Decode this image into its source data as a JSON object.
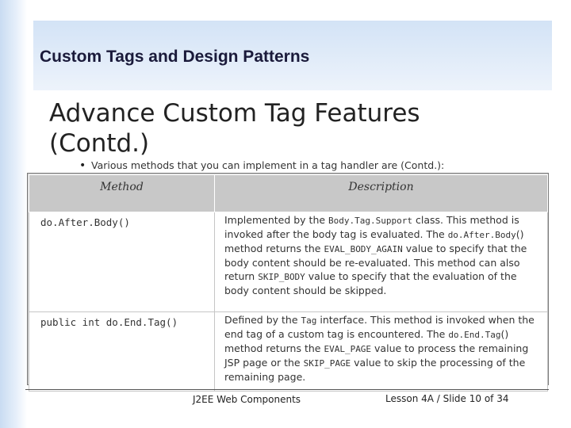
{
  "header": {
    "title": "Custom Tags and Design Patterns"
  },
  "slide": {
    "title": "Advance Custom Tag Features (Contd.)"
  },
  "bullet": {
    "marker": "•",
    "text": "Various  methods that you can implement in a tag handler are (Contd.):"
  },
  "table": {
    "headers": {
      "method": "Method",
      "description": "Description"
    },
    "rows": [
      {
        "method": "do.After.Body()",
        "description": [
          {
            "t": "Implemented by the ",
            "code": false
          },
          {
            "t": "Body.Tag.Support",
            "code": true
          },
          {
            "t": "  class. This method is invoked after the body tag is evaluated. The ",
            "code": false
          },
          {
            "t": "do.After.Body",
            "code": true
          },
          {
            "t": "() method returns the ",
            "code": false
          },
          {
            "t": "EVAL_BODY_AGAIN",
            "code": true
          },
          {
            "t": " value to specify that the body content should be re-evaluated. This method can also return ",
            "code": false
          },
          {
            "t": "SKIP_BODY",
            "code": true
          },
          {
            "t": " value to specify that the evaluation of the body content should be skipped.",
            "code": false
          }
        ]
      },
      {
        "method": "public int do.End.Tag()",
        "description": [
          {
            "t": "Defined by the ",
            "code": false
          },
          {
            "t": "Tag",
            "code": true
          },
          {
            "t": " interface. This method is invoked when the end tag of a custom tag is encountered. The ",
            "code": false
          },
          {
            "t": "do.End.Tag",
            "code": true
          },
          {
            "t": "() method returns the ",
            "code": false
          },
          {
            "t": "EVAL_PAGE",
            "code": true
          },
          {
            "t": " value to process the remaining JSP page or the ",
            "code": false
          },
          {
            "t": "SKIP_PAGE",
            "code": true
          },
          {
            "t": " value to skip the processing of the remaining page.",
            "code": false
          }
        ]
      }
    ]
  },
  "footer": {
    "course": "J2EE Web Components",
    "lesson": "Lesson 4A / Slide 10 of 34"
  }
}
